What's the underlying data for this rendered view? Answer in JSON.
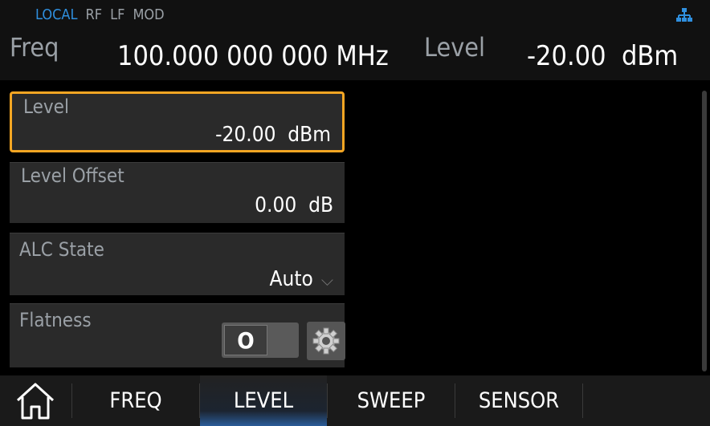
{
  "status": {
    "modes": [
      "LOCAL",
      "RF",
      "LF",
      "MOD"
    ],
    "active_mode": "LOCAL"
  },
  "header": {
    "freq_label": "Freq",
    "freq_value": "100.000 000 000 MHz",
    "level_label": "Level",
    "level_value": "-20.00  dBm"
  },
  "fields": {
    "level": {
      "label": "Level",
      "value": "-20.00  dBm"
    },
    "level_offset": {
      "label": "Level Offset",
      "value": "0.00  dB"
    },
    "alc_state": {
      "label": "ALC State",
      "value": "Auto"
    },
    "flatness": {
      "label": "Flatness",
      "toggle_text": "O"
    }
  },
  "tabs": [
    "FREQ",
    "LEVEL",
    "SWEEP",
    "SENSOR"
  ],
  "active_tab": "LEVEL",
  "colors": {
    "accent_selected": "#f5a623",
    "status_active": "#2f8fde",
    "active_tab_glow": "#2a5c99"
  },
  "icons": {
    "network": "network-icon",
    "home": "home-icon",
    "gear": "gear-icon",
    "dropdown": "chevron-down-icon"
  }
}
